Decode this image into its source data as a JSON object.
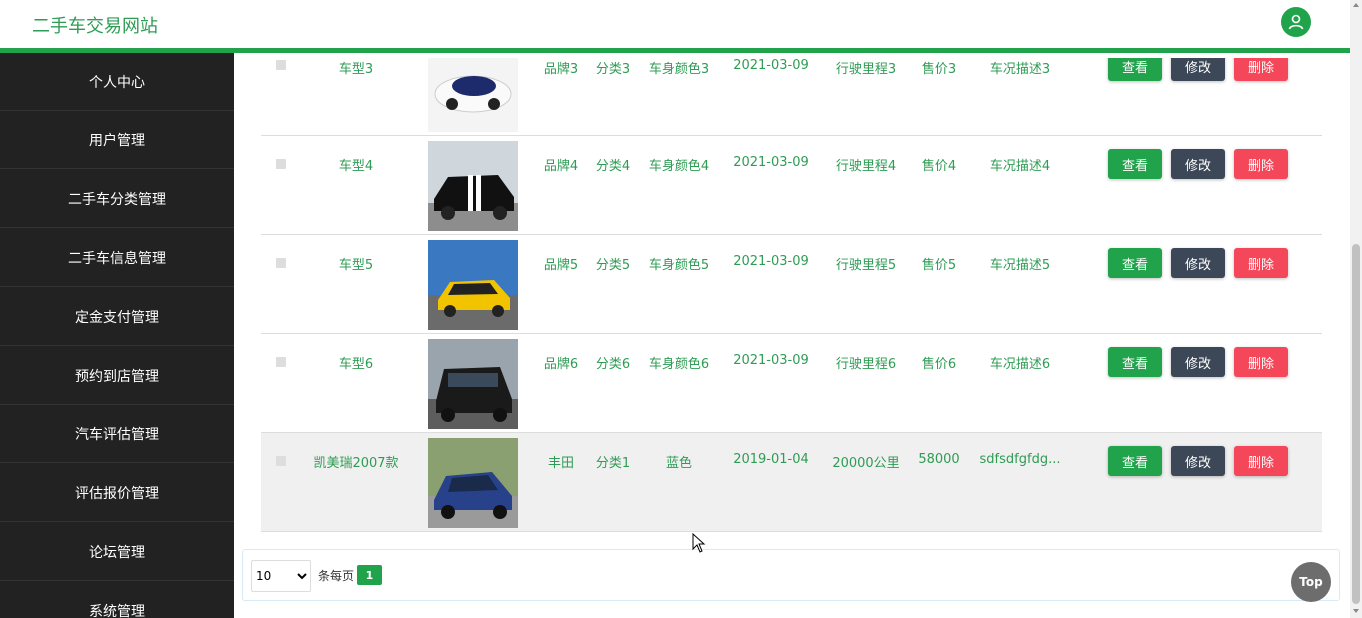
{
  "header": {
    "site_title": "二手车交易网站",
    "avatar_icon": "user-icon"
  },
  "sidebar": {
    "items": [
      {
        "label": "个人中心"
      },
      {
        "label": "用户管理"
      },
      {
        "label": "二手车分类管理"
      },
      {
        "label": "二手车信息管理"
      },
      {
        "label": "定金支付管理"
      },
      {
        "label": "预约到店管理"
      },
      {
        "label": "汽车评估管理"
      },
      {
        "label": "评估报价管理"
      },
      {
        "label": "论坛管理"
      },
      {
        "label": "系统管理"
      }
    ]
  },
  "table": {
    "rows": [
      {
        "model": "车型3",
        "brand": "品牌3",
        "category": "分类3",
        "color": "车身颜色3",
        "date": "2021-03-09",
        "mileage": "行驶里程3",
        "price": "售价3",
        "desc": "车况描述3"
      },
      {
        "model": "车型4",
        "brand": "品牌4",
        "category": "分类4",
        "color": "车身颜色4",
        "date": "2021-03-09",
        "mileage": "行驶里程4",
        "price": "售价4",
        "desc": "车况描述4"
      },
      {
        "model": "车型5",
        "brand": "品牌5",
        "category": "分类5",
        "color": "车身颜色5",
        "date": "2021-03-09",
        "mileage": "行驶里程5",
        "price": "售价5",
        "desc": "车况描述5"
      },
      {
        "model": "车型6",
        "brand": "品牌6",
        "category": "分类6",
        "color": "车身颜色6",
        "date": "2021-03-09",
        "mileage": "行驶里程6",
        "price": "售价6",
        "desc": "车况描述6"
      },
      {
        "model": "凯美瑞2007款",
        "brand": "丰田",
        "category": "分类1",
        "color": "蓝色",
        "date": "2019-01-04",
        "mileage": "20000公里",
        "price": "58000",
        "desc": "sdfsdfgfdg..."
      }
    ],
    "actions": {
      "view": "查看",
      "edit": "修改",
      "delete": "删除"
    }
  },
  "pager": {
    "page_size": "10",
    "per_page_label": "条每页",
    "current_page": "1"
  },
  "top_button": "Top",
  "colors": {
    "primary": "#20a34a",
    "sidebar": "#222222",
    "danger": "#f5475a",
    "secondary": "#3c4858"
  }
}
